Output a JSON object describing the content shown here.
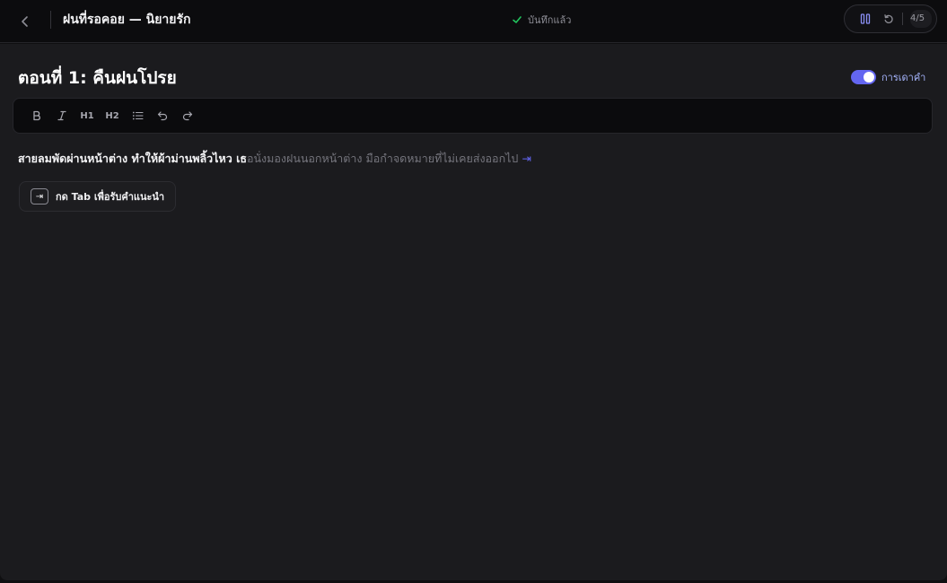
{
  "header": {
    "doc_title": "ฝนที่รอคอย — นิยายรัก",
    "save_status": "บันทึกแล้ว",
    "counter": "4/5",
    "colors": {
      "saved_check": "#22c55e",
      "accent": "#6366f1"
    }
  },
  "editor": {
    "chapter_title": "ตอนที่ 1: คืนฝนโปรย",
    "autocomplete_toggle": {
      "label": "การเดาคำ",
      "on": true
    },
    "toolbar": {
      "tools": [
        "bold-icon",
        "italic-icon",
        "heading-1",
        "heading-2",
        "bullet-list-icon",
        "undo-icon",
        "redo-icon"
      ],
      "h1": "H1",
      "h2": "H2"
    },
    "body": {
      "typed_text": "สายลมพัดผ่านหน้าต่าง ทำให้ผ้าม่านพลิ้วไหว เธ",
      "suggestion_text": "อนั่งมองฝนนอกหน้าต่าง มือกำจดหมายที่ไม่เคยส่งออกไป",
      "accept_glyph": "⇥"
    },
    "tab_hint": {
      "key": "⇥",
      "label": "กด Tab เพื่อรับคำแนะนำ"
    }
  }
}
